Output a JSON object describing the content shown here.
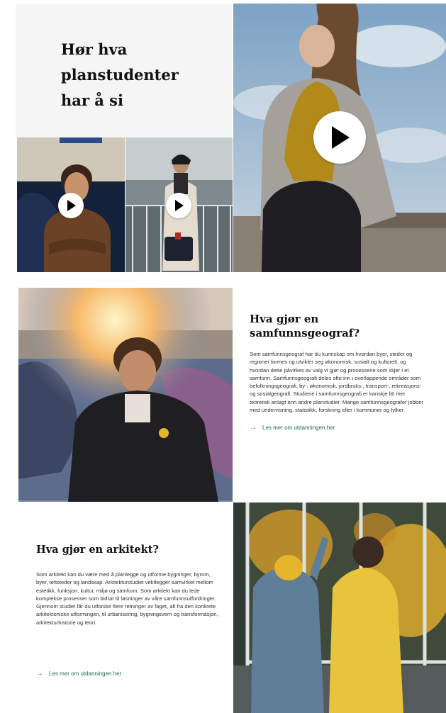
{
  "hero": {
    "title_lines": [
      "Hør hva",
      "planstudenter",
      "har å si"
    ],
    "play_icon": "play-icon"
  },
  "geograf": {
    "heading_lines": [
      "Hva gjør en",
      "samfunnsgeograf?"
    ],
    "body": "Som samfunnsgeograf har du kunnskap om hvordan byer, steder og regioner formes og utvikler seg økonomisk, sosialt og kulturelt, og hvordan dette påvirkes av valg vi gjør og prosessene som skjer i et samfunn. Samfunnsgeografi deles ofte inn i overlappende områder som befolkningsgeografi, by-, økonomisk, jordbruks-, transport-, rekreasjons- og sosialgeografi. Studiene i samfunnsgeografi er kanskje litt mer teoretisk anlagt enn andre planstudier. Mange samfunnsgeografer jobber med undervisning, statistikk, forskning eller i kommuner og fylker.",
    "link": "Les mer om utdanningen her"
  },
  "arkitekt": {
    "heading": "Hva gjør en arkitekt?",
    "body": "Som arkitekt kan du være med å planlegge og utforme bygninger, byrom, byer, tettsteder og landskap. Arkitekturstudiet vektlegger samvirket mellom estetikk, funksjon, kultur, miljø og samfunn. Som arkitekt kan du lede komplekse prosesser som bidrar til løsninger av våre samfunnsutfordringer. Gjennom studiet får du utforske flere retninger av faget, alt fra den konkrete arkitektoniske utformingen, til urbanisering, bygningsvern og transformasjon, arkitekturhistorie og teori.",
    "link": "Les mer om utdanningen her"
  },
  "colors": {
    "accent": "#1f6b50",
    "panel": "#f5f5f5"
  }
}
